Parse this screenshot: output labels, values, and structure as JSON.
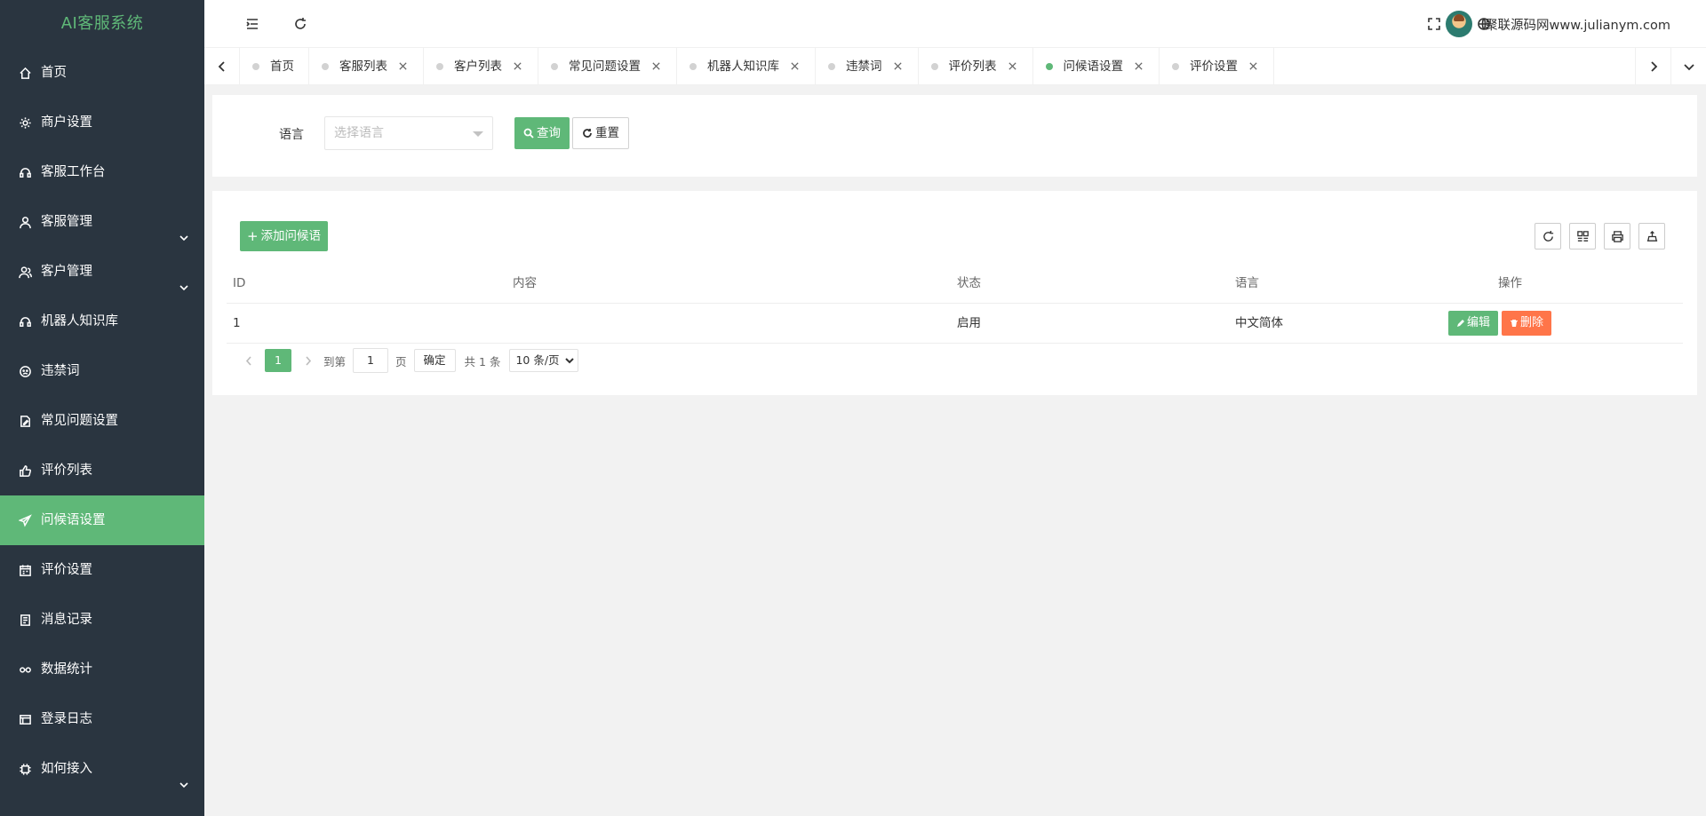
{
  "app": {
    "brand": "AI客服系统"
  },
  "sidebar": {
    "items": [
      {
        "label": "首页",
        "icon": "home-icon",
        "expandable": false,
        "active": false
      },
      {
        "label": "商户设置",
        "icon": "gear-icon",
        "expandable": false,
        "active": false
      },
      {
        "label": "客服工作台",
        "icon": "headset-icon",
        "expandable": false,
        "active": false
      },
      {
        "label": "客服管理",
        "icon": "user-icon",
        "expandable": true,
        "active": false
      },
      {
        "label": "客户管理",
        "icon": "users-icon",
        "expandable": true,
        "active": false
      },
      {
        "label": "机器人知识库",
        "icon": "headset-icon",
        "expandable": false,
        "active": false
      },
      {
        "label": "违禁词",
        "icon": "face-icon",
        "expandable": false,
        "active": false
      },
      {
        "label": "常见问题设置",
        "icon": "edit-doc-icon",
        "expandable": false,
        "active": false
      },
      {
        "label": "评价列表",
        "icon": "thumbs-up-icon",
        "expandable": false,
        "active": false
      },
      {
        "label": "问候语设置",
        "icon": "send-icon",
        "expandable": false,
        "active": true
      },
      {
        "label": "评价设置",
        "icon": "calendar-icon",
        "expandable": false,
        "active": false
      },
      {
        "label": "消息记录",
        "icon": "note-icon",
        "expandable": false,
        "active": false
      },
      {
        "label": "数据统计",
        "icon": "link-icon",
        "expandable": false,
        "active": false
      },
      {
        "label": "登录日志",
        "icon": "window-icon",
        "expandable": false,
        "active": false
      },
      {
        "label": "如何接入",
        "icon": "chip-icon",
        "expandable": true,
        "active": false
      }
    ]
  },
  "header": {
    "user_name": "聚联源码网www.julianym.com"
  },
  "tabs": [
    {
      "label": "首页",
      "closable": false,
      "active": false
    },
    {
      "label": "客服列表",
      "closable": true,
      "active": false
    },
    {
      "label": "客户列表",
      "closable": true,
      "active": false
    },
    {
      "label": "常见问题设置",
      "closable": true,
      "active": false
    },
    {
      "label": "机器人知识库",
      "closable": true,
      "active": false
    },
    {
      "label": "违禁词",
      "closable": true,
      "active": false
    },
    {
      "label": "评价列表",
      "closable": true,
      "active": false
    },
    {
      "label": "问候语设置",
      "closable": true,
      "active": true
    },
    {
      "label": "评价设置",
      "closable": true,
      "active": false
    }
  ],
  "search": {
    "language_label": "语言",
    "language_placeholder": "选择语言",
    "query_label": "查询",
    "reset_label": "重置"
  },
  "table": {
    "add_label": "添加问候语",
    "columns": {
      "id": "ID",
      "content": "内容",
      "status": "状态",
      "language": "语言",
      "actions": "操作"
    },
    "rows": [
      {
        "id": "1",
        "content": "",
        "status": "启用",
        "language": "中文简体",
        "edit_label": "编辑",
        "delete_label": "删除"
      }
    ]
  },
  "pagination": {
    "current_page": "1",
    "goto_prefix": "到第",
    "goto_value": "1",
    "goto_suffix": "页",
    "confirm_label": "确定",
    "total_text": "共 1 条",
    "page_size": "10 条/页"
  },
  "colors": {
    "sidebar_bg": "#2a3540",
    "accent": "#5fb878",
    "danger": "#ff5722"
  }
}
